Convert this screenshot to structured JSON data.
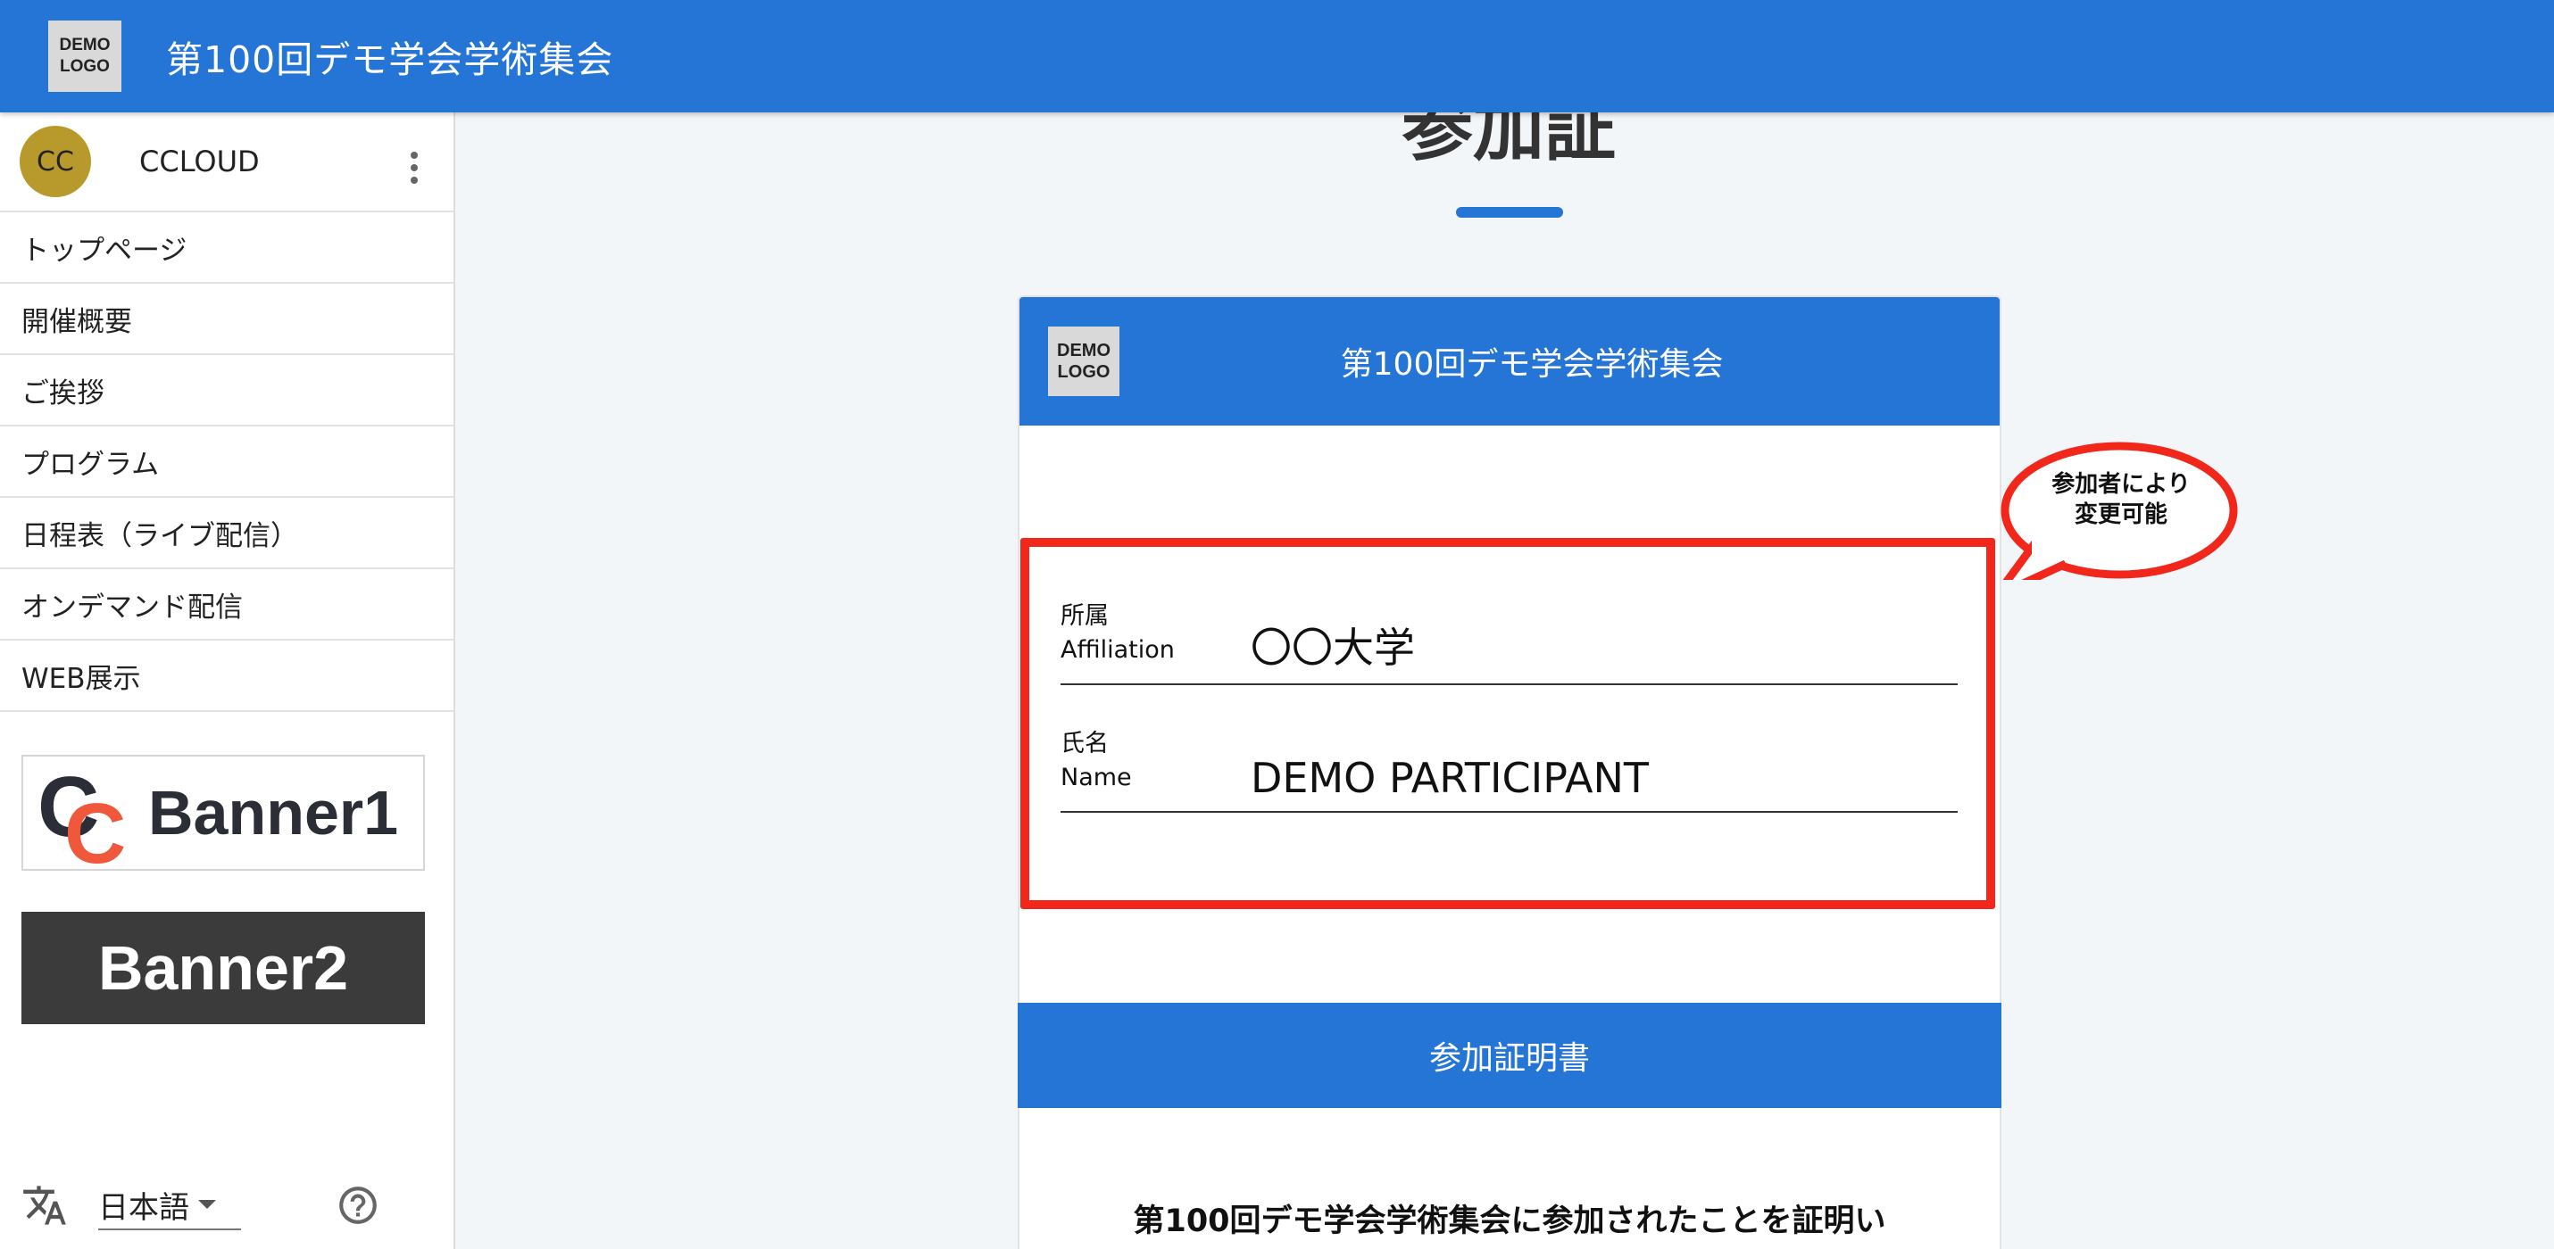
{
  "app": {
    "logo_line1": "DEMO",
    "logo_line2": "LOGO",
    "title": "第100回デモ学会学術集会"
  },
  "user": {
    "initials": "CC",
    "name": "CCLOUD"
  },
  "nav": {
    "items": [
      {
        "label": "トップページ"
      },
      {
        "label": "開催概要"
      },
      {
        "label": "ご挨拶"
      },
      {
        "label": "プログラム"
      },
      {
        "label": "日程表（ライブ配信）"
      },
      {
        "label": "オンデマンド配信"
      },
      {
        "label": "WEB展示"
      }
    ]
  },
  "banners": {
    "banner1_mark_a": "C",
    "banner1_mark_b": "C",
    "banner1_label": "Banner1",
    "banner2_label": "Banner2"
  },
  "footer": {
    "language": "日本語"
  },
  "page": {
    "heading": "参加証"
  },
  "card": {
    "logo_line1": "DEMO",
    "logo_line2": "LOGO",
    "title": "第100回デモ学会学術集会",
    "affiliation_label_ja": "所属",
    "affiliation_label_en": "Affiliation",
    "affiliation_value": "〇〇大学",
    "name_label_ja": "氏名",
    "name_label_en": "Name",
    "name_value": "DEMO PARTICIPANT",
    "certificate_button": "参加証明書",
    "certificate_text": "第100回デモ学会学術集会に参加されたことを証明い"
  },
  "callout": {
    "line1": "参加者により",
    "line2": "変更可能"
  },
  "colors": {
    "brand": "#2575d6",
    "highlight": "#f0271a",
    "avatar": "#b8992b"
  },
  "icons": {
    "translate": "translate-icon",
    "help": "help-icon",
    "menu": "kebab-menu-icon",
    "dropdown": "chevron-down-icon"
  }
}
